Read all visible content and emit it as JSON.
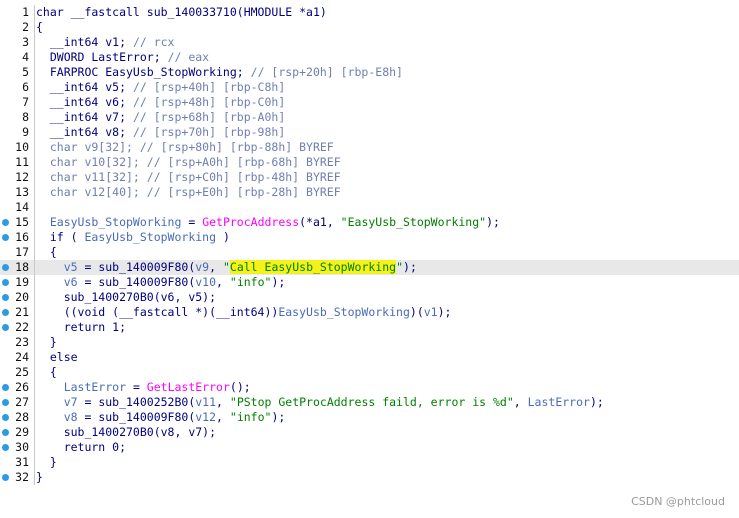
{
  "lines": [
    {
      "n": "1",
      "bp": false,
      "hl": false,
      "parts": [
        {
          "t": "char __fastcall sub_140033710(HMODULE *a1)",
          "c": "k"
        }
      ]
    },
    {
      "n": "2",
      "bp": false,
      "hl": false,
      "parts": [
        {
          "t": "{",
          "c": "k"
        }
      ]
    },
    {
      "n": "3",
      "bp": false,
      "hl": false,
      "parts": [
        {
          "t": "  __int64 v1; ",
          "c": "k"
        },
        {
          "t": "// rcx",
          "c": "c"
        }
      ]
    },
    {
      "n": "4",
      "bp": false,
      "hl": false,
      "parts": [
        {
          "t": "  DWORD LastError; ",
          "c": "k"
        },
        {
          "t": "// eax",
          "c": "c"
        }
      ]
    },
    {
      "n": "5",
      "bp": false,
      "hl": false,
      "parts": [
        {
          "t": "  FARPROC EasyUsb_StopWorking; ",
          "c": "k"
        },
        {
          "t": "// [rsp+20h] [rbp-E8h]",
          "c": "c"
        }
      ]
    },
    {
      "n": "6",
      "bp": false,
      "hl": false,
      "parts": [
        {
          "t": "  __int64 v5; ",
          "c": "k"
        },
        {
          "t": "// [rsp+40h] [rbp-C8h]",
          "c": "c"
        }
      ]
    },
    {
      "n": "7",
      "bp": false,
      "hl": false,
      "parts": [
        {
          "t": "  __int64 v6; ",
          "c": "k"
        },
        {
          "t": "// [rsp+48h] [rbp-C0h]",
          "c": "c"
        }
      ]
    },
    {
      "n": "8",
      "bp": false,
      "hl": false,
      "parts": [
        {
          "t": "  __int64 v7; ",
          "c": "k"
        },
        {
          "t": "// [rsp+68h] [rbp-A0h]",
          "c": "c"
        }
      ]
    },
    {
      "n": "9",
      "bp": false,
      "hl": false,
      "parts": [
        {
          "t": "  __int64 v8; ",
          "c": "k"
        },
        {
          "t": "// [rsp+70h] [rbp-98h]",
          "c": "c"
        }
      ]
    },
    {
      "n": "10",
      "bp": false,
      "hl": false,
      "parts": [
        {
          "t": "  char v9[32]; ",
          "c": "c"
        },
        {
          "t": "// [rsp+80h] [rbp-88h] BYREF",
          "c": "c"
        }
      ]
    },
    {
      "n": "11",
      "bp": false,
      "hl": false,
      "parts": [
        {
          "t": "  char v10[32]; ",
          "c": "c"
        },
        {
          "t": "// [rsp+A0h] [rbp-68h] BYREF",
          "c": "c"
        }
      ]
    },
    {
      "n": "12",
      "bp": false,
      "hl": false,
      "parts": [
        {
          "t": "  char v11[32]; ",
          "c": "c"
        },
        {
          "t": "// [rsp+C0h] [rbp-48h] BYREF",
          "c": "c"
        }
      ]
    },
    {
      "n": "13",
      "bp": false,
      "hl": false,
      "parts": [
        {
          "t": "  char v12[40]; ",
          "c": "c"
        },
        {
          "t": "// [rsp+E0h] [rbp-28h] BYREF",
          "c": "c"
        }
      ]
    },
    {
      "n": "14",
      "bp": false,
      "hl": false,
      "parts": []
    },
    {
      "n": "15",
      "bp": true,
      "hl": false,
      "parts": [
        {
          "t": "  EasyUsb_StopWorking",
          "c": "v"
        },
        {
          "t": " = ",
          "c": "k"
        },
        {
          "t": "GetProcAddress",
          "c": "g"
        },
        {
          "t": "(*a1, ",
          "c": "k"
        },
        {
          "t": "\"EasyUsb_StopWorking\"",
          "c": "s"
        },
        {
          "t": ");",
          "c": "k"
        }
      ]
    },
    {
      "n": "16",
      "bp": true,
      "hl": false,
      "parts": [
        {
          "t": "  if ( ",
          "c": "k"
        },
        {
          "t": "EasyUsb_StopWorking",
          "c": "v"
        },
        {
          "t": " )",
          "c": "k"
        }
      ]
    },
    {
      "n": "17",
      "bp": false,
      "hl": false,
      "parts": [
        {
          "t": "  {",
          "c": "k"
        }
      ]
    },
    {
      "n": "18",
      "bp": true,
      "hl": true,
      "parts": [
        {
          "t": "    v5",
          "c": "v"
        },
        {
          "t": " = sub_140009F80(",
          "c": "k"
        },
        {
          "t": "v9",
          "c": "v"
        },
        {
          "t": ", ",
          "c": "k"
        },
        {
          "t": "\"",
          "c": "s"
        },
        {
          "t": "Call EasyUsb_StopWorking",
          "c": "s hlw"
        },
        {
          "t": "\"",
          "c": "s"
        },
        {
          "t": ");",
          "c": "k"
        }
      ]
    },
    {
      "n": "19",
      "bp": true,
      "hl": false,
      "parts": [
        {
          "t": "    v6",
          "c": "v"
        },
        {
          "t": " = sub_140009F80(",
          "c": "k"
        },
        {
          "t": "v10",
          "c": "v"
        },
        {
          "t": ", ",
          "c": "k"
        },
        {
          "t": "\"info\"",
          "c": "s"
        },
        {
          "t": ");",
          "c": "k"
        }
      ]
    },
    {
      "n": "20",
      "bp": true,
      "hl": false,
      "parts": [
        {
          "t": "    sub_1400270B0(v6, v5);",
          "c": "k"
        }
      ]
    },
    {
      "n": "21",
      "bp": true,
      "hl": false,
      "parts": [
        {
          "t": "    ((void (__fastcall *)(__int64))",
          "c": "k"
        },
        {
          "t": "EasyUsb_StopWorking",
          "c": "v"
        },
        {
          "t": ")(",
          "c": "k"
        },
        {
          "t": "v1",
          "c": "v"
        },
        {
          "t": ");",
          "c": "k"
        }
      ]
    },
    {
      "n": "22",
      "bp": true,
      "hl": false,
      "parts": [
        {
          "t": "    return 1;",
          "c": "k"
        }
      ]
    },
    {
      "n": "23",
      "bp": false,
      "hl": false,
      "parts": [
        {
          "t": "  }",
          "c": "k"
        }
      ]
    },
    {
      "n": "24",
      "bp": false,
      "hl": false,
      "parts": [
        {
          "t": "  else",
          "c": "k"
        }
      ]
    },
    {
      "n": "25",
      "bp": false,
      "hl": false,
      "parts": [
        {
          "t": "  {",
          "c": "k"
        }
      ]
    },
    {
      "n": "26",
      "bp": true,
      "hl": false,
      "parts": [
        {
          "t": "    LastError",
          "c": "v"
        },
        {
          "t": " = ",
          "c": "k"
        },
        {
          "t": "GetLastError",
          "c": "g"
        },
        {
          "t": "();",
          "c": "k"
        }
      ]
    },
    {
      "n": "27",
      "bp": true,
      "hl": false,
      "parts": [
        {
          "t": "    v7",
          "c": "v"
        },
        {
          "t": " = sub_1400252B0(",
          "c": "k"
        },
        {
          "t": "v11",
          "c": "v"
        },
        {
          "t": ", ",
          "c": "k"
        },
        {
          "t": "\"PStop GetProcAddress faild, error is %d\"",
          "c": "s"
        },
        {
          "t": ", ",
          "c": "k"
        },
        {
          "t": "LastError",
          "c": "v"
        },
        {
          "t": ");",
          "c": "k"
        }
      ]
    },
    {
      "n": "28",
      "bp": true,
      "hl": false,
      "parts": [
        {
          "t": "    v8",
          "c": "v"
        },
        {
          "t": " = sub_140009F80(",
          "c": "k"
        },
        {
          "t": "v12",
          "c": "v"
        },
        {
          "t": ", ",
          "c": "k"
        },
        {
          "t": "\"info\"",
          "c": "s"
        },
        {
          "t": ");",
          "c": "k"
        }
      ]
    },
    {
      "n": "29",
      "bp": true,
      "hl": false,
      "parts": [
        {
          "t": "    sub_1400270B0(v8, v7);",
          "c": "k"
        }
      ]
    },
    {
      "n": "30",
      "bp": true,
      "hl": false,
      "parts": [
        {
          "t": "    return 0;",
          "c": "k"
        }
      ]
    },
    {
      "n": "31",
      "bp": false,
      "hl": false,
      "parts": [
        {
          "t": "  }",
          "c": "k"
        }
      ]
    },
    {
      "n": "32",
      "bp": true,
      "hl": false,
      "parts": [
        {
          "t": "}",
          "c": "k"
        }
      ]
    }
  ],
  "watermark": "CSDN @phtcloud"
}
